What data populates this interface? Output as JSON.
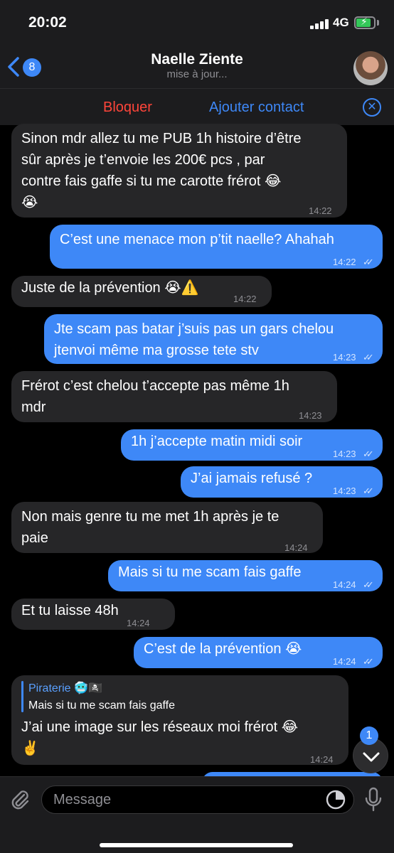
{
  "status_bar": {
    "time": "20:02",
    "network": "4G"
  },
  "header": {
    "back_badge": "8",
    "contact_name": "Naelle Ziente",
    "status": "mise à jour...",
    "avatar_icon": "avatar"
  },
  "actions": {
    "block": "Bloquer",
    "add_contact": "Ajouter contact",
    "close_icon": "close-icon"
  },
  "messages": [
    {
      "dir": "in",
      "lines": [
        "Sinon mdr allez tu me PUB 1h histoire d’être",
        "sûr après je t’envoie les 200€ pcs , par",
        "contre fais gaffe si tu me carotte frérot 😂",
        "😭"
      ],
      "time": "14:22"
    },
    {
      "dir": "out",
      "lines": [
        "C’est une menace mon p’tit naelle? Ahahah"
      ],
      "time": "14:22"
    },
    {
      "dir": "in",
      "lines": [
        "Juste de la prévention 😭⚠️"
      ],
      "time": "14:22"
    },
    {
      "dir": "out",
      "lines": [
        "Jte scam pas batar j’suis pas un gars chelou",
        "jtenvoi même ma grosse tete stv"
      ],
      "time": "14:23"
    },
    {
      "dir": "in",
      "lines": [
        "Frérot c’est chelou t’accepte pas même 1h",
        "mdr"
      ],
      "time": "14:23"
    },
    {
      "dir": "out",
      "lines": [
        "1h j’accepte matin midi soir"
      ],
      "time": "14:23"
    },
    {
      "dir": "out",
      "lines": [
        "J’ai jamais refusé ?"
      ],
      "time": "14:23"
    },
    {
      "dir": "in",
      "lines": [
        "Non mais genre tu me met 1h après je te",
        "paie"
      ],
      "time": "14:24"
    },
    {
      "dir": "out",
      "lines": [
        "Mais si tu me scam fais gaffe"
      ],
      "time": "14:24"
    },
    {
      "dir": "in",
      "lines": [
        "Et tu laisse 48h"
      ],
      "time": "14:24"
    },
    {
      "dir": "out",
      "lines": [
        "C’est de la prévention 😭"
      ],
      "time": "14:24"
    },
    {
      "dir": "in",
      "reply": {
        "author": "Piraterie 🥶🏴‍☠️",
        "text": "Mais si tu me scam fais gaffe"
      },
      "lines": [
        "J’ai une image sur les réseaux moi frérot 😂",
        "✌️"
      ],
      "time": "14:24"
    }
  ],
  "scroll": {
    "unread_count": "1"
  },
  "composer": {
    "placeholder": "Message"
  },
  "colors": {
    "accent": "#3e88f7",
    "danger": "#ff453a",
    "incoming_bubble": "#262628",
    "background": "#000000"
  }
}
